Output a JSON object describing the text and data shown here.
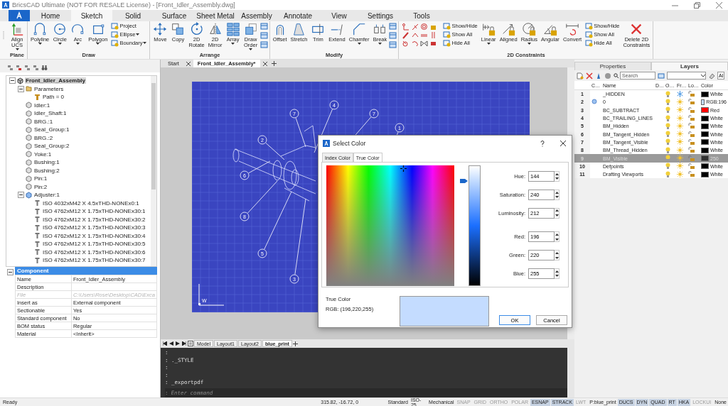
{
  "window": {
    "title": "BricsCAD Ultimate (NOT FOR RESALE License) - [Front_Idler_Assembly.dwg]"
  },
  "ribbon_tabs": [
    {
      "label": "Home",
      "selected": false
    },
    {
      "label": "Sketch",
      "selected": true
    },
    {
      "label": "Solid",
      "selected": false
    },
    {
      "label": "Surface",
      "selected": false
    },
    {
      "label": "Sheet Metal",
      "selected": false
    },
    {
      "label": "Assembly",
      "selected": false
    },
    {
      "label": "Annotate",
      "selected": false
    },
    {
      "label": "View",
      "selected": false
    },
    {
      "label": "Settings",
      "selected": false
    },
    {
      "label": "Tools",
      "selected": false
    }
  ],
  "ribbon_groups": [
    {
      "title": "Plane",
      "items": [
        {
          "kind": "large",
          "label": "Align\nUCS",
          "dropdown": true
        }
      ]
    },
    {
      "title": "Draw",
      "items": [
        {
          "kind": "large",
          "label": "Polyline",
          "dropdown": true
        },
        {
          "kind": "large",
          "label": "Circle",
          "dropdown": true
        },
        {
          "kind": "large",
          "label": "Arc",
          "dropdown": true
        },
        {
          "kind": "large",
          "label": "Polygon",
          "dropdown": true
        },
        {
          "kind": "stack",
          "items": [
            {
              "label": "Project",
              "dropdown": false
            },
            {
              "label": "Ellipse",
              "dropdown": true
            },
            {
              "label": "Boundary",
              "dropdown": true
            }
          ]
        }
      ]
    },
    {
      "title": "Arrange",
      "items": [
        {
          "kind": "large",
          "label": "Move",
          "dropdown": false
        },
        {
          "kind": "large",
          "label": "Copy",
          "dropdown": false
        },
        {
          "kind": "large",
          "label": "2D\nRotate",
          "dropdown": false
        },
        {
          "kind": "large",
          "label": "2D\nMirror",
          "dropdown": false
        },
        {
          "kind": "large",
          "label": "Array",
          "dropdown": true
        },
        {
          "kind": "large",
          "label": "Draw\nOrder",
          "dropdown": true
        },
        {
          "kind": "icon_column"
        }
      ]
    },
    {
      "title": "Modify",
      "items": [
        {
          "kind": "large",
          "label": "Offset",
          "dropdown": false
        },
        {
          "kind": "large",
          "label": "Stretch",
          "dropdown": false
        },
        {
          "kind": "large",
          "label": "Trim",
          "dropdown": false
        },
        {
          "kind": "large",
          "label": "Extend",
          "dropdown": false
        },
        {
          "kind": "large",
          "label": "Chamfer",
          "dropdown": true
        },
        {
          "kind": "large",
          "label": "Break",
          "dropdown": true
        },
        {
          "kind": "icon_column"
        }
      ]
    },
    {
      "title": "2D Constraints",
      "items": [
        {
          "kind": "icon_grid"
        },
        {
          "kind": "stack",
          "items": [
            {
              "label": "Show/Hide",
              "dropdown": false
            },
            {
              "label": "Show All",
              "dropdown": false
            },
            {
              "label": "Hide All",
              "dropdown": false
            }
          ]
        },
        {
          "kind": "large",
          "label": "Linear",
          "dropdown": true
        },
        {
          "kind": "large",
          "label": "Aligned",
          "dropdown": false
        },
        {
          "kind": "large",
          "label": "Radius",
          "dropdown": true
        },
        {
          "kind": "large",
          "label": "Angular",
          "dropdown": false
        },
        {
          "kind": "large",
          "label": "Convert",
          "dropdown": false
        },
        {
          "kind": "stack",
          "items": [
            {
              "label": "Show/Hide",
              "dropdown": false
            },
            {
              "label": "Show All",
              "dropdown": false
            },
            {
              "label": "Hide All",
              "dropdown": false
            }
          ]
        },
        {
          "kind": "large",
          "label": "Delete 2D\nConstraints",
          "dropdown": false
        }
      ]
    }
  ],
  "structure_tree": [
    {
      "label": "Front_Idler_Assembly",
      "kind": "assembly",
      "selected": true,
      "expanded": true,
      "children": [
        {
          "label": "Parameters",
          "kind": "folder",
          "selected": false,
          "expanded": true,
          "children": [
            {
              "label": "Path = 0",
              "kind": "parameter",
              "selected": false
            }
          ]
        },
        {
          "label": "Idler:1",
          "kind": "component",
          "selected": false
        },
        {
          "label": "Idler_Shaft:1",
          "kind": "component",
          "selected": false
        },
        {
          "label": "BRG.:1",
          "kind": "component",
          "selected": false
        },
        {
          "label": "Seal_Group:1",
          "kind": "component",
          "selected": false
        },
        {
          "label": "BRG.:2",
          "kind": "component",
          "selected": false
        },
        {
          "label": "Seal_Group:2",
          "kind": "component",
          "selected": false
        },
        {
          "label": "Yoke:1",
          "kind": "component",
          "selected": false
        },
        {
          "label": "Bushing:1",
          "kind": "component",
          "selected": false
        },
        {
          "label": "Bushing:2",
          "kind": "component",
          "selected": false
        },
        {
          "label": "Pin:1",
          "kind": "component",
          "selected": false
        },
        {
          "label": "Pin:2",
          "kind": "component",
          "selected": false
        },
        {
          "label": "Adjuster:1",
          "kind": "subassembly",
          "selected": false,
          "expanded": true,
          "children": [
            {
              "label": "ISO 4032xM42 X 4.5xTHD-NONEx0:1",
              "kind": "fastener",
              "selected": false
            },
            {
              "label": "ISO 4762xM12 X 1.75xTHD-NONEx30:1",
              "kind": "fastener",
              "selected": false
            },
            {
              "label": "ISO 4762xM12 X 1.75xTHD-NONEx30:2",
              "kind": "fastener",
              "selected": false
            },
            {
              "label": "ISO 4762xM12 X 1.75xTHD-NONEx30:3",
              "kind": "fastener",
              "selected": false
            },
            {
              "label": "ISO 4762xM12 X 1.75xTHD-NONEx30:4",
              "kind": "fastener",
              "selected": false
            },
            {
              "label": "ISO 4762xM12 X 1.75xTHD-NONEx30:5",
              "kind": "fastener",
              "selected": false
            },
            {
              "label": "ISO 4762xM12 X 1.75xTHD-NONEx30:6",
              "kind": "fastener",
              "selected": false
            },
            {
              "label": "ISO 4762xM12 X 1.75xTHD-NONEx30:7",
              "kind": "fastener",
              "selected": false
            }
          ]
        }
      ]
    }
  ],
  "component_properties": {
    "section": "Component",
    "expanded": true,
    "rows": [
      {
        "name": "Name",
        "value": "Front_Idler_Assembly",
        "disabled": false
      },
      {
        "name": "Description",
        "disabled": false
      },
      {
        "name": "File",
        "value": "C:\\Users\\Rose\\Desktop\\CAD\\Exca",
        "disabled": true
      },
      {
        "name": "Insert as",
        "value": "External component",
        "disabled": false
      },
      {
        "name": "Sectionable",
        "value": "Yes",
        "disabled": false
      },
      {
        "name": "Standard component",
        "value": "No",
        "disabled": false
      },
      {
        "name": "BOM status",
        "value": "Regular",
        "disabled": false
      },
      {
        "name": "Material",
        "value": "<Inherit>",
        "disabled": false
      }
    ]
  },
  "document_tabs": [
    {
      "label": "Start",
      "selected": false
    },
    {
      "label": "Front_Idler_Assembly*",
      "selected": true
    }
  ],
  "drawing": {
    "balloons": [
      {
        "label": "7"
      },
      {
        "label": "4"
      },
      {
        "label": "7"
      },
      {
        "label": "1"
      },
      {
        "label": "2"
      },
      {
        "label": "6"
      },
      {
        "label": "8"
      },
      {
        "label": "5"
      },
      {
        "label": "3"
      }
    ],
    "ucs_label": "W"
  },
  "layout_tabs": [
    {
      "label": "Model",
      "selected": false
    },
    {
      "label": "Layout1",
      "selected": false
    },
    {
      "label": "Layout2",
      "selected": false
    },
    {
      "label": "blue_print",
      "selected": true
    }
  ],
  "command_line": {
    "lines": [
      ":",
      ": ._STYLE",
      ":",
      ":",
      ": _exportpdf"
    ],
    "prompt": ":",
    "placeholder": "Enter command"
  },
  "select_color_dialog": {
    "title": "Select Color",
    "tabs": [
      {
        "label": "Index Color",
        "selected": false
      },
      {
        "label": "True Color",
        "selected": true
      }
    ],
    "luminance_slider": {
      "level": 0.87
    },
    "fields": [
      {
        "label": "Hue:",
        "value": "144"
      },
      {
        "label": "Saturation:",
        "value": "240"
      },
      {
        "label": "Luminosity:",
        "value": "212"
      },
      {
        "label": "Red:",
        "value": "196"
      },
      {
        "label": "Green:",
        "value": "220"
      },
      {
        "label": "Blue:",
        "value": "255"
      }
    ],
    "preview_label": "True Color",
    "rgb_text": "RGB: (196,220,255)",
    "preview": {
      "color": "#c4dcff"
    },
    "buttons": [
      "OK",
      "Cancel"
    ]
  },
  "layers_panel": {
    "tabs": [
      {
        "label": "Properties",
        "selected": false
      },
      {
        "label": "Layers",
        "selected": true
      }
    ],
    "search_placeholder": "Search",
    "filter": "Al",
    "columns": [
      "C…",
      "Name",
      "D…",
      "O…",
      "Fr…",
      "Lo…",
      "Color"
    ],
    "rows": [
      {
        "number": "1",
        "name": "_HIDDEN",
        "current": false,
        "frozen": true,
        "color": "#000000",
        "color_name": "White",
        "selected": false
      },
      {
        "number": "2",
        "name": "0",
        "current": true,
        "frozen": false,
        "color": "#c4dcff",
        "color_name": "RGB:196",
        "selected": false
      },
      {
        "number": "3",
        "name": "BC_SUBTRACT",
        "current": false,
        "frozen": false,
        "color": "#ff0000",
        "color_name": "Red",
        "selected": false
      },
      {
        "number": "4",
        "name": "BC_TRAILING_LINES",
        "current": false,
        "frozen": false,
        "color": "#000000",
        "color_name": "White",
        "selected": false
      },
      {
        "number": "5",
        "name": "BM_Hidden",
        "current": false,
        "frozen": false,
        "color": "#000000",
        "color_name": "White",
        "selected": false
      },
      {
        "number": "6",
        "name": "BM_Tangent_Hidden",
        "current": false,
        "frozen": false,
        "color": "#000000",
        "color_name": "White",
        "selected": false
      },
      {
        "number": "7",
        "name": "BM_Tangent_Visible",
        "current": false,
        "frozen": false,
        "color": "#000000",
        "color_name": "White",
        "selected": false
      },
      {
        "number": "8",
        "name": "BM_Thread_Hidden",
        "current": false,
        "frozen": false,
        "color": "#000000",
        "color_name": "White",
        "selected": false
      },
      {
        "number": "9",
        "name": "BM_Visible",
        "current": false,
        "frozen": false,
        "color": "#303030",
        "color_name": "250",
        "selected": true
      },
      {
        "number": "10",
        "name": "Defpoints",
        "current": false,
        "frozen": false,
        "color": "#000000",
        "color_name": "White",
        "selected": false
      },
      {
        "number": "11",
        "name": "Drafting Viewports",
        "current": false,
        "frozen": false,
        "color": "#000000",
        "color_name": "White",
        "selected": false
      }
    ]
  },
  "status_bar": {
    "message": "Ready",
    "coordinates": "315.82, -16.72, 0",
    "items": [
      {
        "label": "Standard",
        "kind": "text"
      },
      {
        "label": "ISO-25",
        "kind": "text"
      },
      {
        "label": "Mechanical",
        "kind": "text"
      },
      {
        "label": "SNAP",
        "kind": "toggle",
        "on": false
      },
      {
        "label": "GRID",
        "kind": "toggle",
        "on": false
      },
      {
        "label": "ORTHO",
        "kind": "toggle",
        "on": false
      },
      {
        "label": "POLAR",
        "kind": "toggle",
        "on": false
      },
      {
        "label": "ESNAP",
        "kind": "toggle",
        "on": true
      },
      {
        "label": "STRACK",
        "kind": "toggle",
        "on": true
      },
      {
        "label": "LWT",
        "kind": "toggle",
        "on": false
      },
      {
        "label": "P:blue_print",
        "kind": "text"
      },
      {
        "label": "DUCS",
        "kind": "toggle",
        "on": true
      },
      {
        "label": "DYN",
        "kind": "toggle",
        "on": true
      },
      {
        "label": "QUAD",
        "kind": "toggle",
        "on": true
      },
      {
        "label": "RT",
        "kind": "toggle",
        "on": true
      },
      {
        "label": "HKA",
        "kind": "toggle",
        "on": true
      },
      {
        "label": "LOCKUI",
        "kind": "toggle",
        "on": false
      },
      {
        "label": "None",
        "kind": "text"
      }
    ]
  }
}
